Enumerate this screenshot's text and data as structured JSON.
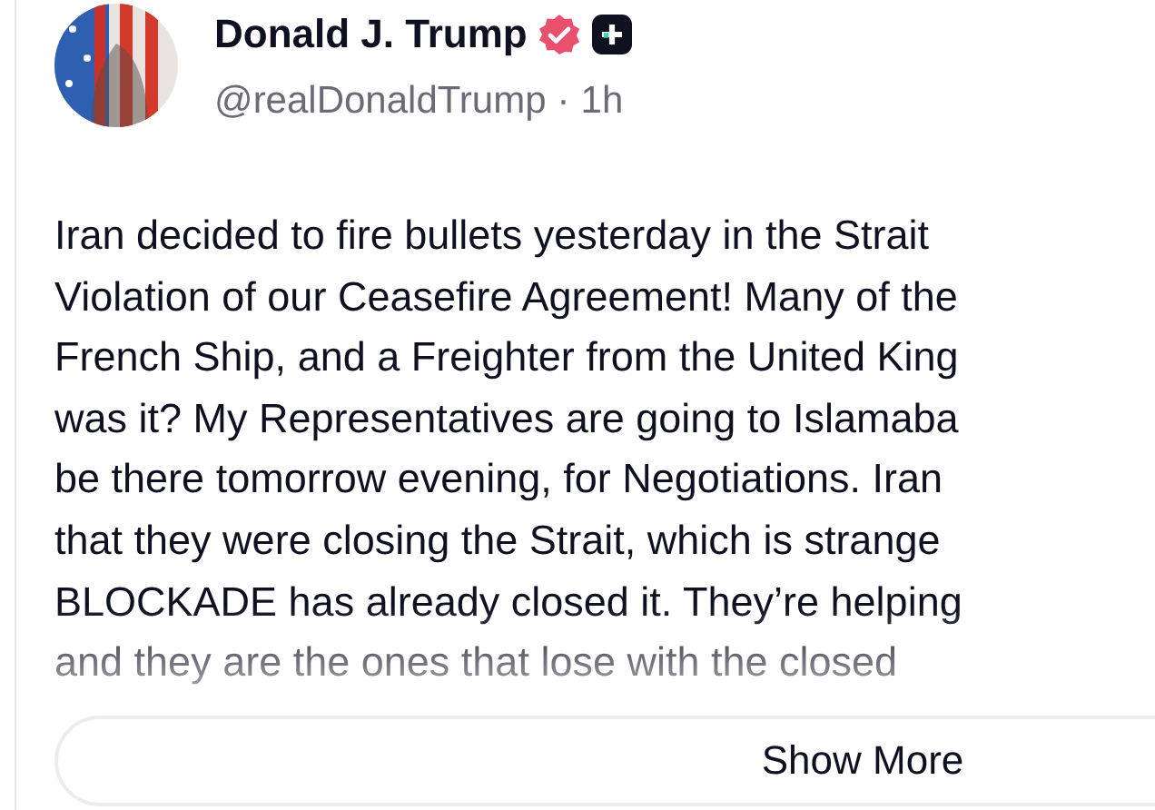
{
  "post": {
    "author": {
      "name": "Donald J. Trump",
      "verified": true,
      "handle": "@realDonaldTrump",
      "separator": "·",
      "time": "1h"
    },
    "lines": [
      "Iran decided to fire bullets yesterday in the Strait",
      "Violation of our Ceasefire Agreement! Many of the",
      "French Ship, and a Freighter from the United King",
      "was it? My Representatives are going to Islamaba",
      "be there tomorrow evening, for Negotiations. Iran",
      "that they were closing the Strait, which is strange",
      "BLOCKADE has already closed it. They’re helping",
      "and they are the ones that lose with the closed"
    ],
    "show_more": "Show More"
  }
}
